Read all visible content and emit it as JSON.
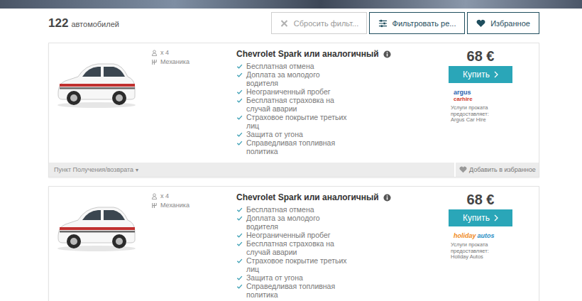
{
  "header": {
    "count": "122",
    "count_label": "автомобилей",
    "buttons": [
      {
        "kind": "reset",
        "label": "Сбросить фильт..."
      },
      {
        "kind": "filter",
        "label": "Фильтровать ре..."
      },
      {
        "kind": "favorites",
        "label": "Избранное"
      }
    ]
  },
  "cars": [
    {
      "seats": "x 4",
      "transmission": "Механика",
      "title": "Chevrolet Spark или аналогичный",
      "features": [
        "Бесплатная отмена",
        "Доплата за молодого водителя",
        "Неограниченный пробег",
        "Бесплатная страховка на случай аварии",
        "Страховое покрытие третьих лиц",
        "Защита от угона",
        "Справедливая топливная политика"
      ],
      "price": "68 €",
      "buy": "Купить",
      "logo": {
        "kind": "argus",
        "lines": [
          "argus",
          "carhire"
        ]
      },
      "provider_label": "Услуги проката предоставляет:",
      "provider": "Argus Car Hire",
      "footer": {
        "pickup": "Пункт Получения/возврата",
        "caret": "▾",
        "favorite": "Добавить в избранное"
      }
    },
    {
      "seats": "x 4",
      "transmission": "Механика",
      "title": "Chevrolet Spark или аналогичный",
      "features": [
        "Бесплатная отмена",
        "Доплата за молодого водителя",
        "Неограниченный пробег",
        "Бесплатная страховка на случай аварии",
        "Страховое покрытие третьих лиц",
        "Защита от угона",
        "Справедливая топливная политика"
      ],
      "price": "68 €",
      "buy": "Купить",
      "logo": {
        "kind": "holiday",
        "lines": [
          "holiday",
          "autos"
        ]
      },
      "provider_label": "Услуги проката предоставляет:",
      "provider": "Holiday Autos"
    }
  ]
}
